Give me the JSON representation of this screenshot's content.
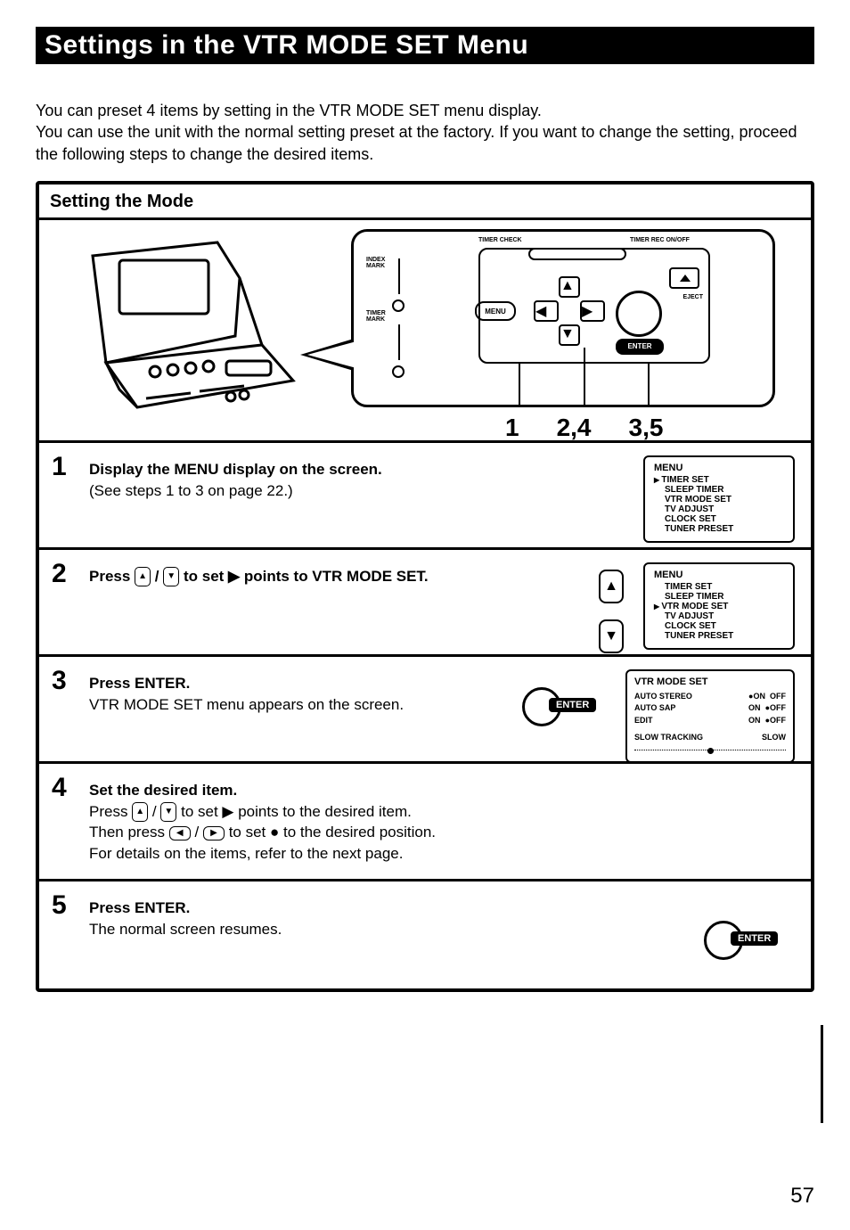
{
  "title": "Settings in the VTR MODE SET Menu",
  "intro": "You can preset 4 items by setting in the VTR MODE SET menu display.\nYou can use the unit with the normal setting preset at the factory. If you want to change the setting, proceed the following steps to change the desired items.",
  "section_heading": "Setting the Mode",
  "diagram_labels": {
    "timer_check": "TIMER CHECK",
    "timer_rec_onoff": "TIMER REC ON/OFF",
    "index_mark": "INDEX MARK",
    "timer_mark": "TIMER MARK",
    "eject": "EJECT",
    "menu_key": "MENU",
    "enter_key": "ENTER",
    "callout_1": "1",
    "callout_24": "2,4",
    "callout_35": "3,5"
  },
  "steps": {
    "s1": {
      "num": "1",
      "bold": "Display the MENU display on the screen.",
      "plain": "(See steps 1 to 3 on page 22.)"
    },
    "s2": {
      "num": "2",
      "bold_pre": "Press ",
      "bold_mid": " / ",
      "bold_post": " to set ▶ points to VTR MODE SET."
    },
    "s3": {
      "num": "3",
      "bold": "Press ENTER.",
      "plain": "VTR MODE SET menu appears on the screen."
    },
    "s4": {
      "num": "4",
      "bold": "Set the desired item.",
      "line2_pre": "Press ",
      "line2_mid": " / ",
      "line2_post": " to set ▶ points to the desired item.",
      "line3_pre": "Then press ",
      "line3_mid": " / ",
      "line3_post": " to set ● to the desired position.",
      "line4": "For details on the items, refer to the next page."
    },
    "s5": {
      "num": "5",
      "bold": "Press ENTER.",
      "plain": "The normal screen resumes."
    }
  },
  "menu_screen_1": {
    "header": "MENU",
    "items": [
      "TIMER SET",
      "SLEEP TIMER",
      "VTR MODE SET",
      "TV ADJUST",
      "CLOCK SET",
      "TUNER PRESET"
    ],
    "marked_index": 0
  },
  "menu_screen_2": {
    "header": "MENU",
    "items": [
      "TIMER SET",
      "SLEEP TIMER",
      "VTR MODE SET",
      "TV ADJUST",
      "CLOCK SET",
      "TUNER PRESET"
    ],
    "marked_index": 2
  },
  "vtr_screen": {
    "header": "VTR MODE SET",
    "rows": [
      {
        "label": "AUTO STEREO",
        "left": "●ON",
        "right": "OFF"
      },
      {
        "label": "AUTO SAP",
        "left": "ON",
        "right": "●OFF"
      },
      {
        "label": "EDIT",
        "left": "ON",
        "right": "●OFF"
      }
    ],
    "tracking_label": "SLOW TRACKING",
    "tracking_value": "SLOW"
  },
  "enter_label": "ENTER",
  "page_number": "57"
}
